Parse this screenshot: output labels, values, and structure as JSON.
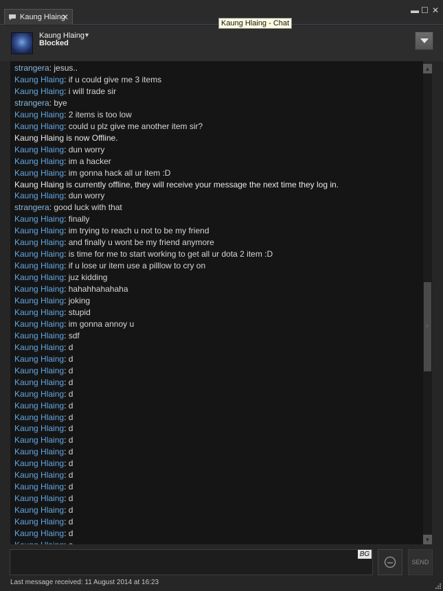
{
  "window": {
    "tab_title": "Kaung Hlaing",
    "tab_close": "✕",
    "tooltip": "Kaung Hlaing - Chat",
    "minimize": "▬",
    "maximize": "☐",
    "close": "✕"
  },
  "friend": {
    "name": "Kaung Hlaing",
    "status": "Blocked"
  },
  "messages": [
    {
      "who": "strangera",
      "text": ": jesus.."
    },
    {
      "who": "Kaung Hlaing",
      "text": ": if u could give me 3 items"
    },
    {
      "who": "Kaung Hlaing",
      "text": ": i will trade sir"
    },
    {
      "who": "strangera",
      "text": ": bye"
    },
    {
      "who": "Kaung Hlaing",
      "text": ": 2 items is too low"
    },
    {
      "who": "Kaung Hlaing",
      "text": ": could u plz give me another item sir?"
    },
    {
      "system": "Kaung Hlaing is now Offline."
    },
    {
      "who": "Kaung Hlaing",
      "text": ": dun worry"
    },
    {
      "who": "Kaung Hlaing",
      "text": ": im a hacker"
    },
    {
      "who": "Kaung Hlaing",
      "text": ": im gonna hack all ur item :D"
    },
    {
      "system": "Kaung Hlaing is currently offline, they will receive your message the next time they log in."
    },
    {
      "who": "Kaung Hlaing",
      "text": ": dun worry"
    },
    {
      "who": "strangera",
      "text": ": good luck with that"
    },
    {
      "who": "Kaung Hlaing",
      "text": ": finally"
    },
    {
      "who": "Kaung Hlaing",
      "text": ": im trying to reach u not to be my friend"
    },
    {
      "who": "Kaung Hlaing",
      "text": ": and finally u wont be my friend anymore"
    },
    {
      "who": "Kaung Hlaing",
      "text": ": is time for me to start working to get all ur dota 2 item :D"
    },
    {
      "who": "Kaung Hlaing",
      "text": ": if u lose ur item use a pilllow to cry on"
    },
    {
      "who": "Kaung Hlaing",
      "text": ": juz kidding"
    },
    {
      "who": "Kaung Hlaing",
      "text": ": hahahhahahaha"
    },
    {
      "who": "Kaung Hlaing",
      "text": ": joking"
    },
    {
      "who": "Kaung Hlaing",
      "text": ": stupid"
    },
    {
      "who": "Kaung Hlaing",
      "text": ": im gonna annoy u"
    },
    {
      "who": "Kaung Hlaing",
      "text": ": sdf"
    },
    {
      "who": "Kaung Hlaing",
      "text": ": d"
    },
    {
      "who": "Kaung Hlaing",
      "text": ": d"
    },
    {
      "who": "Kaung Hlaing",
      "text": ": d"
    },
    {
      "who": "Kaung Hlaing",
      "text": ": d"
    },
    {
      "who": "Kaung Hlaing",
      "text": ": d"
    },
    {
      "who": "Kaung Hlaing",
      "text": ": d"
    },
    {
      "who": "Kaung Hlaing",
      "text": ": d"
    },
    {
      "who": "Kaung Hlaing",
      "text": ": d"
    },
    {
      "who": "Kaung Hlaing",
      "text": ": d"
    },
    {
      "who": "Kaung Hlaing",
      "text": ": d"
    },
    {
      "who": "Kaung Hlaing",
      "text": ": d"
    },
    {
      "who": "Kaung Hlaing",
      "text": ": d"
    },
    {
      "who": "Kaung Hlaing",
      "text": ": d"
    },
    {
      "who": "Kaung Hlaing",
      "text": ": d"
    },
    {
      "who": "Kaung Hlaing",
      "text": ": d"
    },
    {
      "who": "Kaung Hlaing",
      "text": ": d"
    },
    {
      "who": "Kaung Hlaing",
      "text": ": d"
    },
    {
      "who": "Kaung Hlaing",
      "text": ": e"
    }
  ],
  "input": {
    "bg_label": "BG",
    "send_label": "SEND"
  },
  "footer": {
    "last_message": "Last message received: 11 August 2014 at 16:23"
  },
  "colors": {
    "friend_name": "#62a7e3",
    "self_name": "#8bb9e0",
    "background": "#151515"
  },
  "icons": [
    "chat-bubble-icon",
    "dropdown-caret-icon",
    "options-arrow-icon",
    "emoticon-icon",
    "resize-grip-icon"
  ]
}
